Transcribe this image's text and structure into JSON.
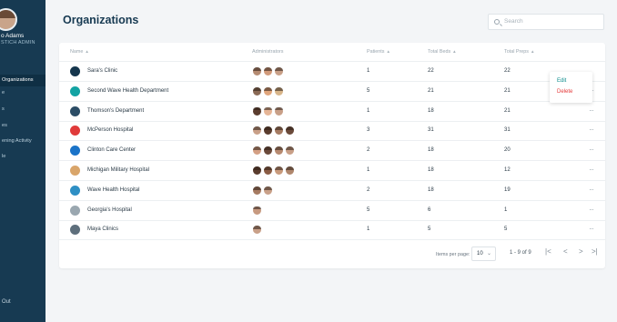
{
  "sidebar": {
    "user_name": "o Adams",
    "user_role": "STICH ADMIN",
    "items": [
      {
        "label": "Organizations",
        "active": true
      },
      {
        "label": "e",
        "active": false
      },
      {
        "label": "s",
        "active": false
      },
      {
        "label": "es",
        "active": false
      },
      {
        "label": "ening Activity",
        "active": false
      },
      {
        "label": "le",
        "active": false
      }
    ],
    "logout_label": "Out"
  },
  "header": {
    "title": "Organizations",
    "search_placeholder": "Search"
  },
  "table": {
    "columns": [
      "Name",
      "Administrators",
      "Patients",
      "Total Beds",
      "Total Preps"
    ],
    "rows": [
      {
        "name": "Sara's Clinic",
        "icon_color": "#15364d",
        "avatars": [
          "#b58b72",
          "#d19a7a",
          "#c9a088"
        ],
        "patients": "1",
        "total_beds": "22",
        "total_preps": "22"
      },
      {
        "name": "Second Wave Health Department",
        "icon_color": "#13a3a3",
        "avatars": [
          "#8a6a55",
          "#e0a57b",
          "#d8b58a"
        ],
        "patients": "5",
        "total_beds": "21",
        "total_preps": "21"
      },
      {
        "name": "Thomson's Department",
        "icon_color": "#2c4d66",
        "avatars": [
          "#5b3d2e",
          "#e6b596",
          "#c9a088"
        ],
        "patients": "1",
        "total_beds": "18",
        "total_preps": "21"
      },
      {
        "name": "McPerson Hospital",
        "icon_color": "#e03a3a",
        "avatars": [
          "#c9a088",
          "#5b3d2e",
          "#a67b62",
          "#6b4a3a"
        ],
        "patients": "3",
        "total_beds": "31",
        "total_preps": "31"
      },
      {
        "name": "Clinton Care Center",
        "icon_color": "#1a73c8",
        "avatars": [
          "#d4a084",
          "#6b4a3a",
          "#b78a70",
          "#c9a088"
        ],
        "patients": "2",
        "total_beds": "18",
        "total_preps": "20"
      },
      {
        "name": "Michigan Military Hospital",
        "icon_color": "#d9a56a",
        "avatars": [
          "#5b3d2e",
          "#8a5c44",
          "#c99a7c",
          "#b0876d"
        ],
        "patients": "1",
        "total_beds": "18",
        "total_preps": "12"
      },
      {
        "name": "Wave Health Hospital",
        "icon_color": "#2e8fc4",
        "avatars": [
          "#a67b62",
          "#c9a088"
        ],
        "patients": "2",
        "total_beds": "18",
        "total_preps": "19"
      },
      {
        "name": "Georgia's Hospital",
        "icon_color": "#9aa7b0",
        "avatars": [
          "#c79a80"
        ],
        "patients": "5",
        "total_beds": "6",
        "total_preps": "1"
      },
      {
        "name": "Maya Clinics",
        "icon_color": "#5e6f7c",
        "avatars": [
          "#c9a088"
        ],
        "patients": "1",
        "total_beds": "5",
        "total_preps": "5"
      }
    ]
  },
  "menu": {
    "edit_label": "Edit",
    "delete_label": "Delete"
  },
  "pagination": {
    "items_per_page_label": "Items per page:",
    "items_per_page_value": "10",
    "range_text": "1 - 9 of 9",
    "first_glyph": "|<",
    "prev_glyph": "<",
    "next_glyph": ">",
    "last_glyph": ">|"
  }
}
